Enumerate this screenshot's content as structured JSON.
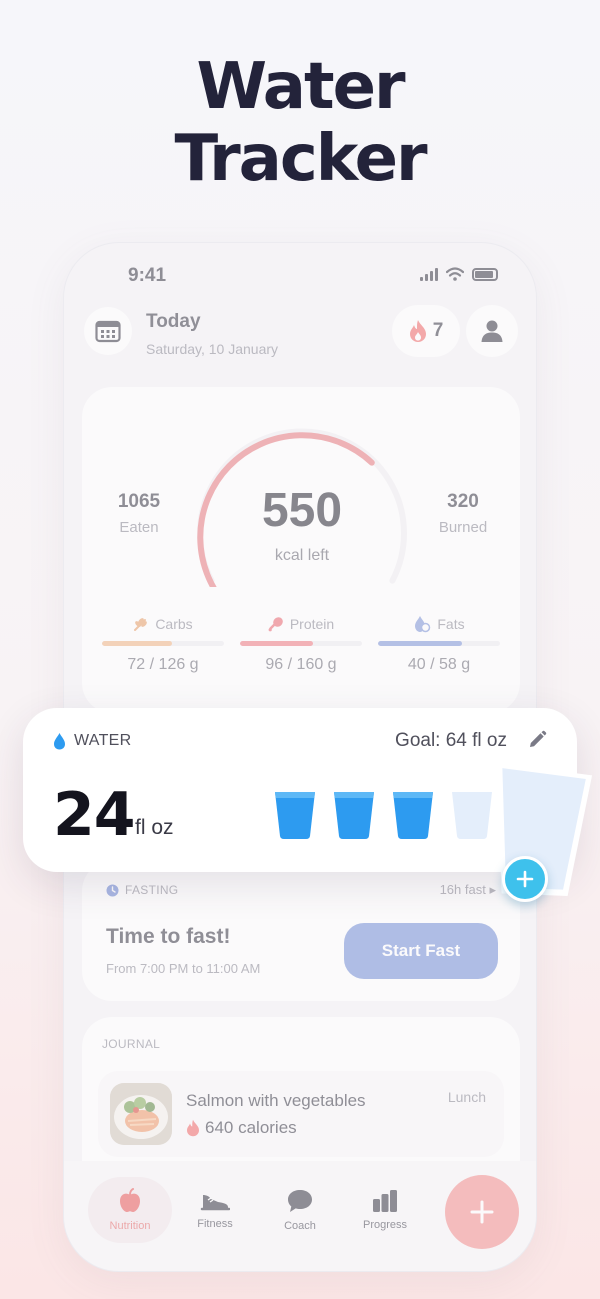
{
  "headline": {
    "line1": "Water",
    "line2": "Tracker"
  },
  "status_bar": {
    "time": "9:41"
  },
  "header": {
    "title": "Today",
    "date": "Saturday, 10 January",
    "streak": "7"
  },
  "calories": {
    "eaten_value": "1065",
    "eaten_label": "Eaten",
    "left_value": "550",
    "left_label": "kcal left",
    "burned_value": "320",
    "burned_label": "Burned",
    "gauge_progress": 0.66,
    "macros": [
      {
        "name": "Carbs",
        "value": "72 / 126 g",
        "progress": 0.57,
        "color": "#f0b787"
      },
      {
        "name": "Protein",
        "value": "96 / 160 g",
        "progress": 0.6,
        "color": "#ee7c84"
      },
      {
        "name": "Fats",
        "value": "40 / 58 g",
        "progress": 0.69,
        "color": "#7f96d8"
      }
    ]
  },
  "water": {
    "label": "WATER",
    "goal": "Goal: 64 fl oz",
    "amount": "24",
    "unit": "fl oz",
    "glasses_filled": 3,
    "glasses_total": 4,
    "color": "#2d9bf0"
  },
  "fasting": {
    "label": "FASTING",
    "type": "16h fast",
    "title": "Time to fast!",
    "window": "From 7:00 PM to 11:00 AM",
    "button": "Start Fast"
  },
  "journal": {
    "label": "JOURNAL",
    "meal_name": "Salmon with vegetables",
    "meal_calories": "640 calories",
    "meal_time": "Lunch"
  },
  "tabs": [
    {
      "label": "Nutrition",
      "icon": "apple-icon"
    },
    {
      "label": "Fitness",
      "icon": "shoe-icon"
    },
    {
      "label": "Coach",
      "icon": "chat-icon"
    },
    {
      "label": "Progress",
      "icon": "bar-chart-icon"
    }
  ],
  "colors": {
    "accent": "#f28f8f",
    "water": "#2d9bf0",
    "add_button": "#3ec1ec",
    "fast_button": "#7591d8"
  }
}
